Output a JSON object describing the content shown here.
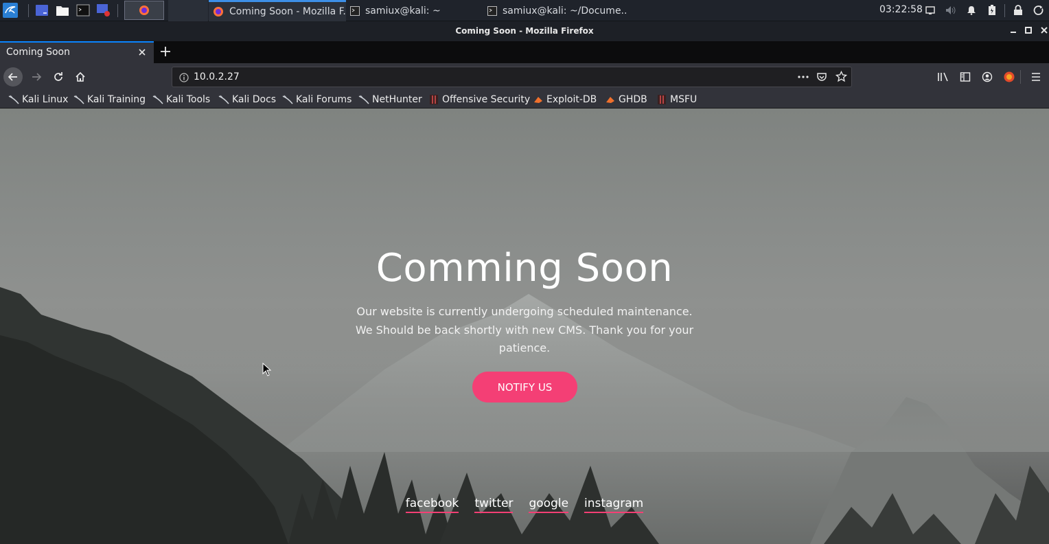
{
  "panel": {
    "clock": "03:22:58",
    "tasks": [
      {
        "label": "Coming Soon - Mozilla F..."
      },
      {
        "label": "samiux@kali: ~"
      },
      {
        "label": "samiux@kali: ~/Docume..."
      }
    ]
  },
  "window": {
    "title": "Coming Soon - Mozilla Firefox"
  },
  "tab": {
    "label": "Coming Soon"
  },
  "urlbar": {
    "url": "10.0.2.27"
  },
  "bookmarks": [
    {
      "label": "Kali Linux",
      "icon": "kali-dragon-icon"
    },
    {
      "label": "Kali Training",
      "icon": "kali-dragon-icon"
    },
    {
      "label": "Kali Tools",
      "icon": "kali-dragon-icon"
    },
    {
      "label": "Kali Docs",
      "icon": "kali-dragon-icon"
    },
    {
      "label": "Kali Forums",
      "icon": "kali-dragon-icon"
    },
    {
      "label": "NetHunter",
      "icon": "kali-dragon-icon"
    },
    {
      "label": "Offensive Security",
      "icon": "offsec-icon"
    },
    {
      "label": "Exploit-DB",
      "icon": "exploitdb-icon"
    },
    {
      "label": "GHDB",
      "icon": "exploitdb-icon"
    },
    {
      "label": "MSFU",
      "icon": "offsec-icon"
    }
  ],
  "page": {
    "title": "Comming Soon",
    "text": "Our website is currently undergoing scheduled maintenance. We Should be back shortly with new CMS. Thank you for your patience.",
    "button": "NOTIFY US",
    "social": [
      "facebook",
      "twitter",
      "google",
      "instagram"
    ]
  },
  "colors": {
    "accent": "#f43f75",
    "tab_highlight": "#0a84ff",
    "toolbar": "#32333a"
  }
}
